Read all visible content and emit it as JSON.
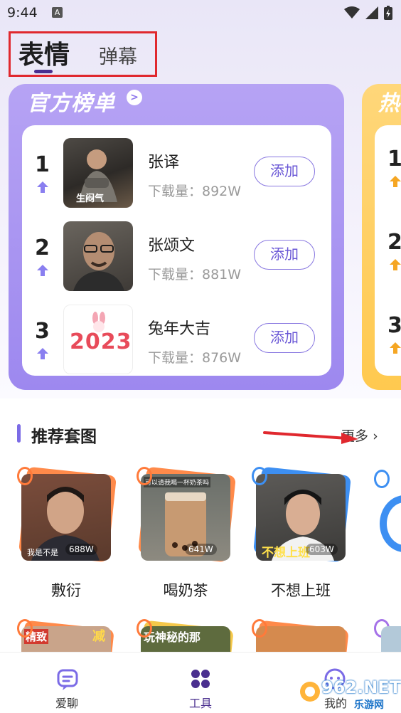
{
  "status_bar": {
    "time": "9:44",
    "notification_badge": "A"
  },
  "header": {
    "tab_active": "表情",
    "tab_inactive": "弹幕"
  },
  "rank_panel": {
    "title": "官方榜单",
    "items": [
      {
        "rank": "1",
        "name": "张译",
        "downloads": "下载量：892W",
        "add_label": "添加",
        "thumb_caption": "生闷气"
      },
      {
        "rank": "2",
        "name": "张颂文",
        "downloads": "下载量：881W",
        "add_label": "添加"
      },
      {
        "rank": "3",
        "name": "兔年大吉",
        "downloads": "下载量：876W",
        "add_label": "添加",
        "thumb_text": "2023"
      }
    ]
  },
  "hot_panel": {
    "title": "热",
    "ranks": [
      "1",
      "2",
      "3"
    ]
  },
  "recommend": {
    "title": "推荐套图",
    "more_label": "更多",
    "packs": [
      {
        "name": "敷衍",
        "count": "688W",
        "caption": "我是不是"
      },
      {
        "name": "喝奶茶",
        "count": "641W",
        "caption": "可以请我喝一杯奶茶吗"
      },
      {
        "name": "不想上班",
        "count": "603W",
        "caption": "不想上班"
      }
    ],
    "row2_captions": [
      "精致",
      "减",
      "玩神秘的那"
    ]
  },
  "bottom_nav": {
    "items": [
      {
        "label": "爱聊",
        "icon": "chat-icon"
      },
      {
        "label": "工具",
        "icon": "grid-icon"
      },
      {
        "label": "我的",
        "icon": "profile-icon"
      }
    ]
  },
  "watermark_logo": {
    "text": "962.NET",
    "sub": "乐游网"
  },
  "colors": {
    "accent": "#7b6be6",
    "rank_panel": "#a08cf0",
    "hot_panel": "#ffc94f",
    "highlight_box": "#e0282e"
  }
}
